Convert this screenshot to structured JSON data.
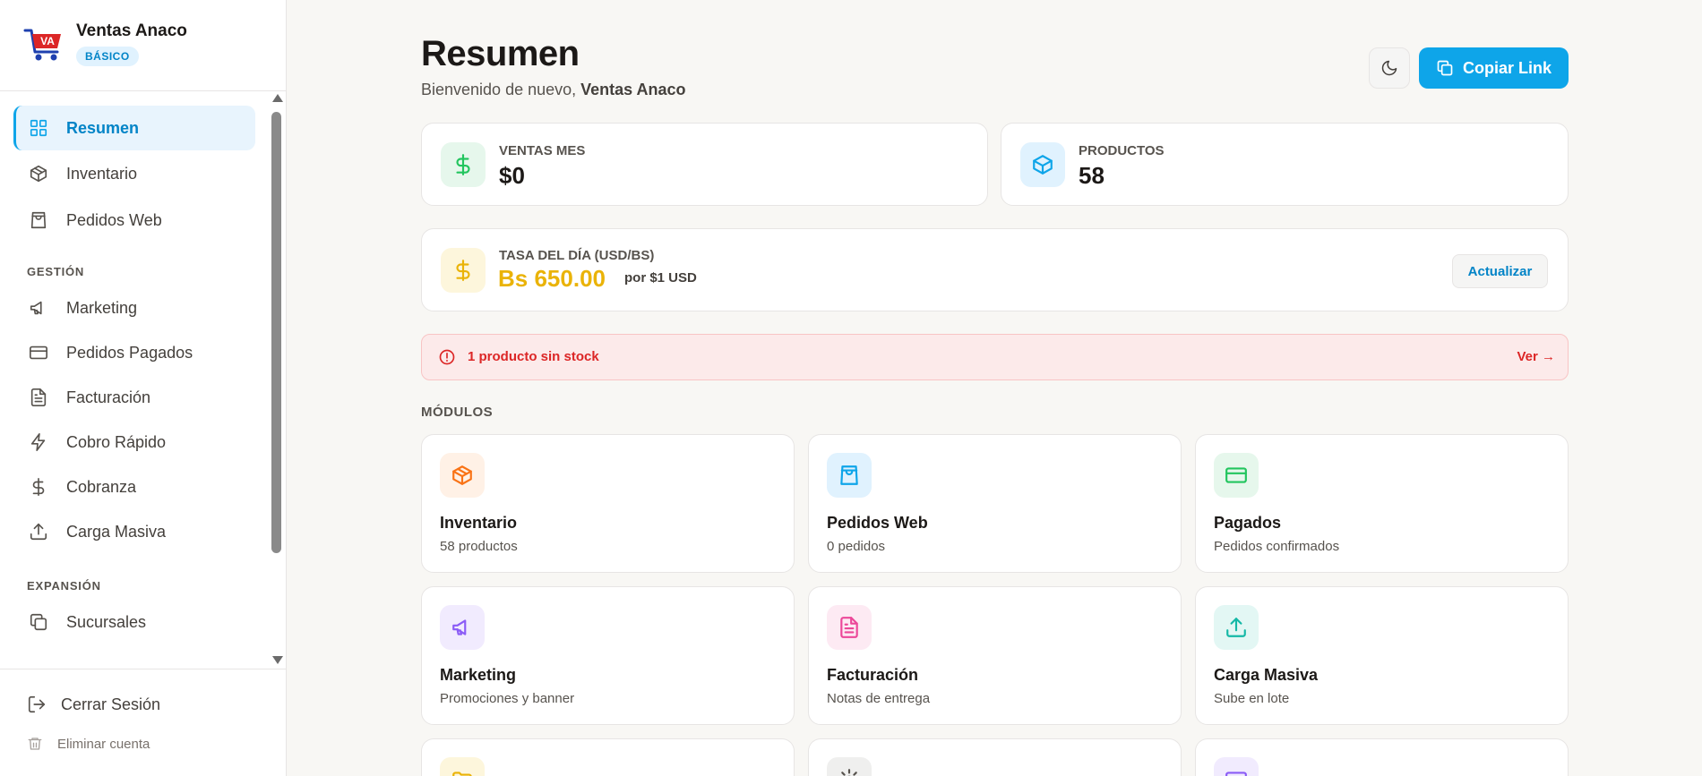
{
  "brand": {
    "name": "Ventas Anaco",
    "plan": "BÁSICO",
    "logo_text": "VA"
  },
  "sidebar": {
    "items": [
      {
        "label": "Resumen",
        "icon": "grid-icon",
        "active": true
      },
      {
        "label": "Inventario",
        "icon": "box-icon"
      },
      {
        "label": "Pedidos Web",
        "icon": "shopping-bag-icon"
      }
    ],
    "section_gestion": "GESTIÓN",
    "gestion_items": [
      {
        "label": "Marketing",
        "icon": "megaphone-icon"
      },
      {
        "label": "Pedidos Pagados",
        "icon": "credit-card-icon"
      },
      {
        "label": "Facturación",
        "icon": "file-text-icon"
      },
      {
        "label": "Cobro Rápido",
        "icon": "zap-icon"
      },
      {
        "label": "Cobranza",
        "icon": "dollar-icon"
      },
      {
        "label": "Carga Masiva",
        "icon": "upload-icon"
      }
    ],
    "section_expansion": "EXPANSIÓN",
    "expansion_items": [
      {
        "label": "Sucursales",
        "icon": "copy-icon"
      }
    ],
    "logout": "Cerrar Sesión",
    "delete_account": "Eliminar cuenta"
  },
  "header": {
    "title": "Resumen",
    "welcome_prefix": "Bienvenido de nuevo,",
    "welcome_name": "Ventas Anaco",
    "copy_link": "Copiar Link"
  },
  "stats": {
    "sales": {
      "label": "VENTAS MES",
      "value": "$0"
    },
    "products": {
      "label": "PRODUCTOS",
      "value": "58"
    }
  },
  "rate": {
    "label": "TASA DEL DÍA (USD/BS)",
    "value": "Bs 650.00",
    "unit": "por $1 USD",
    "update_button": "Actualizar"
  },
  "alert": {
    "text": "1 producto sin stock",
    "link": "Ver →"
  },
  "modules_label": "MÓDULOS",
  "modules": [
    {
      "title": "Inventario",
      "subtitle": "58 productos",
      "icon": "box-icon",
      "color": "#f97316",
      "bg": "#fff1e6"
    },
    {
      "title": "Pedidos Web",
      "subtitle": "0 pedidos",
      "icon": "shopping-bag-icon",
      "color": "#0ea5e9",
      "bg": "#e0f2fe"
    },
    {
      "title": "Pagados",
      "subtitle": "Pedidos confirmados",
      "icon": "credit-card-icon",
      "color": "#22c55e",
      "bg": "#e6f7ec"
    },
    {
      "title": "Marketing",
      "subtitle": "Promociones y banner",
      "icon": "megaphone-icon",
      "color": "#8b5cf6",
      "bg": "#f1ebfe"
    },
    {
      "title": "Facturación",
      "subtitle": "Notas de entrega",
      "icon": "file-text-icon",
      "color": "#ec4899",
      "bg": "#fdeaf3"
    },
    {
      "title": "Carga Masiva",
      "subtitle": "Sube en lote",
      "icon": "upload-icon",
      "color": "#14b8a6",
      "bg": "#e3f7f4"
    }
  ],
  "colors": {
    "accent": "#0ea5e9",
    "alert": "#dc2626",
    "rate": "#eab308"
  }
}
